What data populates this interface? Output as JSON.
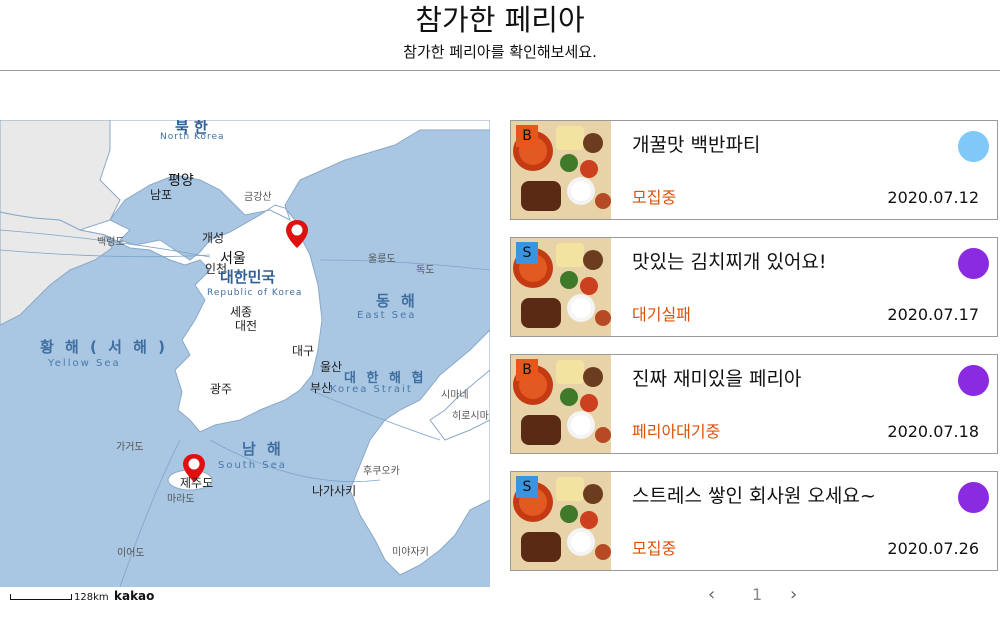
{
  "header": {
    "title": "참가한 페리아",
    "subtitle": "참가한 페리아를 확인해보세요."
  },
  "map": {
    "labels": {
      "north_korea": "북 한",
      "north_korea_en": "North Korea",
      "pyongyang": "평양",
      "nampo": "남포",
      "kaesong": "개성",
      "seoul": "서울",
      "incheon": "인천",
      "south_korea": "대한민국",
      "south_korea_en": "Republic of Korea",
      "sejong": "세종",
      "daejeon": "대전",
      "daegu": "대구",
      "ulsan": "울산",
      "busan": "부산",
      "gwangju": "광주",
      "yellow_sea": "황 해 ( 서 해 )",
      "yellow_sea_en": "Yellow Sea",
      "east_sea": "동 해",
      "east_sea_en": "East Sea",
      "south_sea": "남 해",
      "south_sea_en": "South Sea",
      "korea_strait": "대 한 해 협",
      "korea_strait_en": "Korea Strait",
      "jeju": "제주도",
      "marado": "마라도",
      "gageodo": "가거도",
      "ieodo": "이어도",
      "baengnyeongdo": "백령도",
      "ulleungdo": "울릉도",
      "dokdo": "독도",
      "geumgangsan": "금강산",
      "shimane": "시마네",
      "hiroshima": "히로시마",
      "fukuoka": "후쿠오카",
      "nagasaki": "나가사키",
      "miyazaki": "미야자키"
    },
    "scale": "128km",
    "brand": "kakao",
    "marker_icon": "map-pin-icon"
  },
  "cards": [
    {
      "badge": "B",
      "badge_color": "#e8561c",
      "title": "개꿀맛 백반파티",
      "status": "모집중",
      "date": "2020.07.12",
      "dot_color": "#7fc8f8"
    },
    {
      "badge": "S",
      "badge_color": "#3a94e0",
      "title": "맛있는 김치찌개 있어요!",
      "status": "대기실패",
      "date": "2020.07.17",
      "dot_color": "#8a2be2"
    },
    {
      "badge": "B",
      "badge_color": "#e8561c",
      "title": "진짜 재미있을 페리아",
      "status": "페리아대기중",
      "date": "2020.07.18",
      "dot_color": "#8a2be2"
    },
    {
      "badge": "S",
      "badge_color": "#3a94e0",
      "title": "스트레스 쌓인 회사원 오세요~",
      "status": "모집중",
      "date": "2020.07.26",
      "dot_color": "#8a2be2"
    }
  ],
  "pagination": {
    "prev": "‹",
    "current": "1",
    "next": "›"
  },
  "colors": {
    "status_text": "#d9530a",
    "sea": "#a9c7e3",
    "land": "#ffffff"
  }
}
